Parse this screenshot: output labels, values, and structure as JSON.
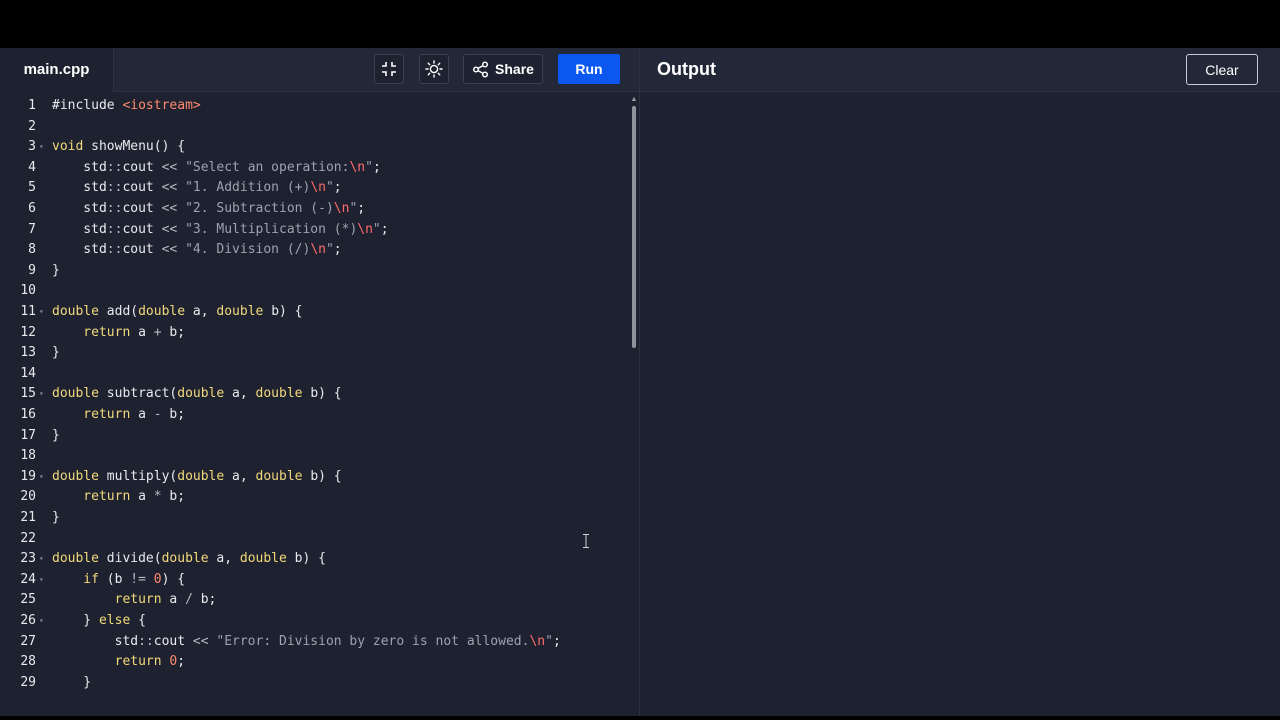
{
  "editor": {
    "file_tab": "main.cpp",
    "toolbar": {
      "fullscreen_icon": "exit-fullscreen-icon",
      "theme_icon": "sun-icon",
      "share_label": "Share",
      "share_icon": "share-icon",
      "run_label": "Run"
    },
    "code_lines": [
      {
        "n": "1",
        "fold": false,
        "tokens": [
          {
            "t": "#include ",
            "c": "plain"
          },
          {
            "t": "<iostream>",
            "c": "inc"
          }
        ]
      },
      {
        "n": "2",
        "fold": false,
        "tokens": []
      },
      {
        "n": "3",
        "fold": true,
        "tokens": [
          {
            "t": "void ",
            "c": "kw"
          },
          {
            "t": "showMenu() {",
            "c": "plain"
          }
        ]
      },
      {
        "n": "4",
        "fold": false,
        "tokens": [
          {
            "t": "    std",
            "c": "plain"
          },
          {
            "t": "::",
            "c": "op"
          },
          {
            "t": "cout ",
            "c": "plain"
          },
          {
            "t": "<< ",
            "c": "op"
          },
          {
            "t": "\"Select an operation:",
            "c": "str"
          },
          {
            "t": "\\n",
            "c": "esc"
          },
          {
            "t": "\"",
            "c": "str"
          },
          {
            "t": ";",
            "c": "plain"
          }
        ]
      },
      {
        "n": "5",
        "fold": false,
        "tokens": [
          {
            "t": "    std",
            "c": "plain"
          },
          {
            "t": "::",
            "c": "op"
          },
          {
            "t": "cout ",
            "c": "plain"
          },
          {
            "t": "<< ",
            "c": "op"
          },
          {
            "t": "\"1. Addition (+)",
            "c": "str"
          },
          {
            "t": "\\n",
            "c": "esc"
          },
          {
            "t": "\"",
            "c": "str"
          },
          {
            "t": ";",
            "c": "plain"
          }
        ]
      },
      {
        "n": "6",
        "fold": false,
        "tokens": [
          {
            "t": "    std",
            "c": "plain"
          },
          {
            "t": "::",
            "c": "op"
          },
          {
            "t": "cout ",
            "c": "plain"
          },
          {
            "t": "<< ",
            "c": "op"
          },
          {
            "t": "\"2. Subtraction (-)",
            "c": "str"
          },
          {
            "t": "\\n",
            "c": "esc"
          },
          {
            "t": "\"",
            "c": "str"
          },
          {
            "t": ";",
            "c": "plain"
          }
        ]
      },
      {
        "n": "7",
        "fold": false,
        "tokens": [
          {
            "t": "    std",
            "c": "plain"
          },
          {
            "t": "::",
            "c": "op"
          },
          {
            "t": "cout ",
            "c": "plain"
          },
          {
            "t": "<< ",
            "c": "op"
          },
          {
            "t": "\"3. Multiplication (*)",
            "c": "str"
          },
          {
            "t": "\\n",
            "c": "esc"
          },
          {
            "t": "\"",
            "c": "str"
          },
          {
            "t": ";",
            "c": "plain"
          }
        ]
      },
      {
        "n": "8",
        "fold": false,
        "tokens": [
          {
            "t": "    std",
            "c": "plain"
          },
          {
            "t": "::",
            "c": "op"
          },
          {
            "t": "cout ",
            "c": "plain"
          },
          {
            "t": "<< ",
            "c": "op"
          },
          {
            "t": "\"4. Division (/)",
            "c": "str"
          },
          {
            "t": "\\n",
            "c": "esc"
          },
          {
            "t": "\"",
            "c": "str"
          },
          {
            "t": ";",
            "c": "plain"
          }
        ]
      },
      {
        "n": "9",
        "fold": false,
        "tokens": [
          {
            "t": "}",
            "c": "plain"
          }
        ]
      },
      {
        "n": "10",
        "fold": false,
        "tokens": []
      },
      {
        "n": "11",
        "fold": true,
        "tokens": [
          {
            "t": "double ",
            "c": "kw"
          },
          {
            "t": "add(",
            "c": "plain"
          },
          {
            "t": "double ",
            "c": "kw"
          },
          {
            "t": "a, ",
            "c": "plain"
          },
          {
            "t": "double ",
            "c": "kw"
          },
          {
            "t": "b) {",
            "c": "plain"
          }
        ]
      },
      {
        "n": "12",
        "fold": false,
        "tokens": [
          {
            "t": "    return ",
            "c": "kw"
          },
          {
            "t": "a ",
            "c": "plain"
          },
          {
            "t": "+ ",
            "c": "op"
          },
          {
            "t": "b;",
            "c": "plain"
          }
        ]
      },
      {
        "n": "13",
        "fold": false,
        "tokens": [
          {
            "t": "}",
            "c": "plain"
          }
        ]
      },
      {
        "n": "14",
        "fold": false,
        "tokens": []
      },
      {
        "n": "15",
        "fold": true,
        "tokens": [
          {
            "t": "double ",
            "c": "kw"
          },
          {
            "t": "subtract(",
            "c": "plain"
          },
          {
            "t": "double ",
            "c": "kw"
          },
          {
            "t": "a, ",
            "c": "plain"
          },
          {
            "t": "double ",
            "c": "kw"
          },
          {
            "t": "b) {",
            "c": "plain"
          }
        ]
      },
      {
        "n": "16",
        "fold": false,
        "tokens": [
          {
            "t": "    return ",
            "c": "kw"
          },
          {
            "t": "a ",
            "c": "plain"
          },
          {
            "t": "- ",
            "c": "op"
          },
          {
            "t": "b;",
            "c": "plain"
          }
        ]
      },
      {
        "n": "17",
        "fold": false,
        "tokens": [
          {
            "t": "}",
            "c": "plain"
          }
        ]
      },
      {
        "n": "18",
        "fold": false,
        "tokens": []
      },
      {
        "n": "19",
        "fold": true,
        "tokens": [
          {
            "t": "double ",
            "c": "kw"
          },
          {
            "t": "multiply(",
            "c": "plain"
          },
          {
            "t": "double ",
            "c": "kw"
          },
          {
            "t": "a, ",
            "c": "plain"
          },
          {
            "t": "double ",
            "c": "kw"
          },
          {
            "t": "b) {",
            "c": "plain"
          }
        ]
      },
      {
        "n": "20",
        "fold": false,
        "tokens": [
          {
            "t": "    return ",
            "c": "kw"
          },
          {
            "t": "a ",
            "c": "plain"
          },
          {
            "t": "* ",
            "c": "op"
          },
          {
            "t": "b;",
            "c": "plain"
          }
        ]
      },
      {
        "n": "21",
        "fold": false,
        "tokens": [
          {
            "t": "}",
            "c": "plain"
          }
        ]
      },
      {
        "n": "22",
        "fold": false,
        "tokens": []
      },
      {
        "n": "23",
        "fold": true,
        "tokens": [
          {
            "t": "double ",
            "c": "kw"
          },
          {
            "t": "divide(",
            "c": "plain"
          },
          {
            "t": "double ",
            "c": "kw"
          },
          {
            "t": "a, ",
            "c": "plain"
          },
          {
            "t": "double ",
            "c": "kw"
          },
          {
            "t": "b) {",
            "c": "plain"
          }
        ]
      },
      {
        "n": "24",
        "fold": true,
        "tokens": [
          {
            "t": "    if ",
            "c": "kw"
          },
          {
            "t": "(b ",
            "c": "plain"
          },
          {
            "t": "!= ",
            "c": "op"
          },
          {
            "t": "0",
            "c": "num"
          },
          {
            "t": ") {",
            "c": "plain"
          }
        ]
      },
      {
        "n": "25",
        "fold": false,
        "tokens": [
          {
            "t": "        return ",
            "c": "kw"
          },
          {
            "t": "a ",
            "c": "plain"
          },
          {
            "t": "/ ",
            "c": "op"
          },
          {
            "t": "b;",
            "c": "plain"
          }
        ]
      },
      {
        "n": "26",
        "fold": true,
        "tokens": [
          {
            "t": "    } ",
            "c": "plain"
          },
          {
            "t": "else ",
            "c": "kw"
          },
          {
            "t": "{",
            "c": "plain"
          }
        ]
      },
      {
        "n": "27",
        "fold": false,
        "tokens": [
          {
            "t": "        std",
            "c": "plain"
          },
          {
            "t": "::",
            "c": "op"
          },
          {
            "t": "cout ",
            "c": "plain"
          },
          {
            "t": "<< ",
            "c": "op"
          },
          {
            "t": "\"Error: Division by zero is not allowed.",
            "c": "str"
          },
          {
            "t": "\\n",
            "c": "esc"
          },
          {
            "t": "\"",
            "c": "str"
          },
          {
            "t": ";",
            "c": "plain"
          }
        ]
      },
      {
        "n": "28",
        "fold": false,
        "tokens": [
          {
            "t": "        return ",
            "c": "kw"
          },
          {
            "t": "0",
            "c": "num"
          },
          {
            "t": ";",
            "c": "plain"
          }
        ]
      },
      {
        "n": "29",
        "fold": false,
        "tokens": [
          {
            "t": "    }",
            "c": "plain"
          }
        ]
      }
    ],
    "fold_icon": "fold-arrow-icon"
  },
  "output": {
    "title": "Output",
    "clear_label": "Clear"
  },
  "colors": {
    "background": "#1e2230",
    "toolbar": "#232838",
    "run_button": "#0b57f0",
    "keyword": "#f2d97b",
    "string": "#9aa3af",
    "escape": "#ff6b6b"
  }
}
